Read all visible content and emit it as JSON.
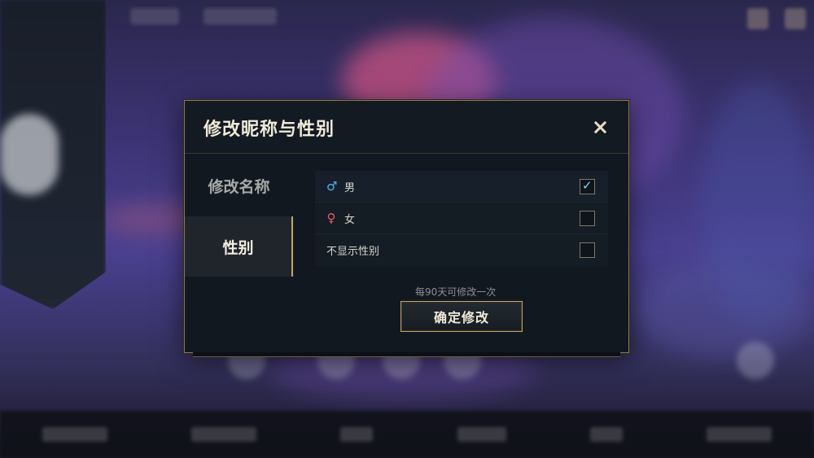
{
  "dialog": {
    "title": "修改昵称与性别",
    "close_icon": "close-icon"
  },
  "nav": {
    "items": [
      {
        "label": "修改名称",
        "active": false
      },
      {
        "label": "性别",
        "active": true
      }
    ]
  },
  "gender_options": [
    {
      "symbol": "♂",
      "icon": "male-symbol-icon",
      "label": "男",
      "checked": true
    },
    {
      "symbol": "♀",
      "icon": "female-symbol-icon",
      "label": "女",
      "checked": false
    },
    {
      "symbol": "",
      "icon": "",
      "label": "不显示性别",
      "checked": false
    }
  ],
  "hint": "每90天可修改一次",
  "confirm_label": "确定修改",
  "colors": {
    "accent_gold": "#c5a766",
    "male_blue": "#4fb4f0",
    "female_red": "#f05a6a",
    "dialog_bg": "#111820"
  }
}
